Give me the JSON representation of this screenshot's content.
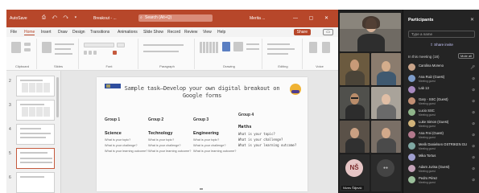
{
  "ppt": {
    "autosave": "AutoSave",
    "quick_access": "⎙ ↶ ↷ ▾",
    "file_name": "Breakout - ...",
    "search_placeholder": "Search (Alt+Q)",
    "user": "Merita ...",
    "window_controls": "— ▢ ✕",
    "menu_tabs": [
      "File",
      "Home",
      "Insert",
      "Draw",
      "Design",
      "Transitions",
      "Animations",
      "Slide Show",
      "Record",
      "Review",
      "View",
      "Help"
    ],
    "share_label": "Share",
    "comments_label": "▭",
    "ribbon_groups": [
      "Clipboard",
      "Slides",
      "Font",
      "Paragraph",
      "Drawing",
      "Editing",
      "Voice"
    ],
    "slide_numbers": [
      "2",
      "3",
      "4",
      "5",
      "6"
    ],
    "selected_slide": "5",
    "slide": {
      "title": "Sample task–Develop your own digital breakout on Google forms",
      "groups": [
        {
          "name": "Group 1",
          "subject": "Science",
          "questions": [
            "What is your topic?",
            "What is your challenge?",
            "What is your learning outcome?"
          ]
        },
        {
          "name": "Group 2",
          "subject": "Technology",
          "questions": [
            "What is your topic?",
            "What is your challenge?",
            "What is your learning outcome?"
          ]
        },
        {
          "name": "Group 3",
          "subject": "Engineering",
          "questions": [
            "What is your topic?",
            "What is your challenge?",
            "What is your learning outcome?"
          ]
        },
        {
          "name": "Group 4",
          "subject": "Maths",
          "questions": [
            "What is your topic?",
            "What is your challenge?",
            "What is your learning outcome?"
          ]
        }
      ]
    }
  },
  "teams": {
    "tile_initials": "NŠ",
    "tile_self_label": "Nives Šiljević",
    "panel": {
      "title": "Participants",
      "close": "✕",
      "search_placeholder": "Type a name",
      "share_invite": "⇪ Share invite",
      "section": "In this meeting (18)",
      "mute_all": "Mute all",
      "participants": [
        {
          "name": "Carolina Moreno",
          "role": "",
          "color": "#c9a48a"
        },
        {
          "name": "Ana Ruiz (Guest)",
          "role": "Meeting guest",
          "color": "#7d9bc9"
        },
        {
          "name": "Lab 13",
          "role": "",
          "color": "#a88abf"
        },
        {
          "name": "Gary - SSC (Guest)",
          "role": "Meeting guest",
          "color": "#c28f74"
        },
        {
          "name": "Lucio SSC",
          "role": "Meeting guest",
          "color": "#8fb58a"
        },
        {
          "name": "Luke Simon (Guest)",
          "role": "Meeting guest",
          "color": "#d1b37a"
        },
        {
          "name": "Ana Frei (Guest)",
          "role": "Meeting guest",
          "color": "#b3798d"
        },
        {
          "name": "Merik Danielsen OSTRIKEN GU",
          "role": "Meeting guest",
          "color": "#7fa8a3"
        },
        {
          "name": "Mika Tortus",
          "role": "",
          "color": "#9f9fcf"
        },
        {
          "name": "Adam Jurisa (Guest)",
          "role": "Meeting guest",
          "color": "#c4a2b8"
        },
        {
          "name": "Pedro Pérez",
          "role": "Meeting guest",
          "color": "#9bbf9b"
        }
      ]
    }
  }
}
